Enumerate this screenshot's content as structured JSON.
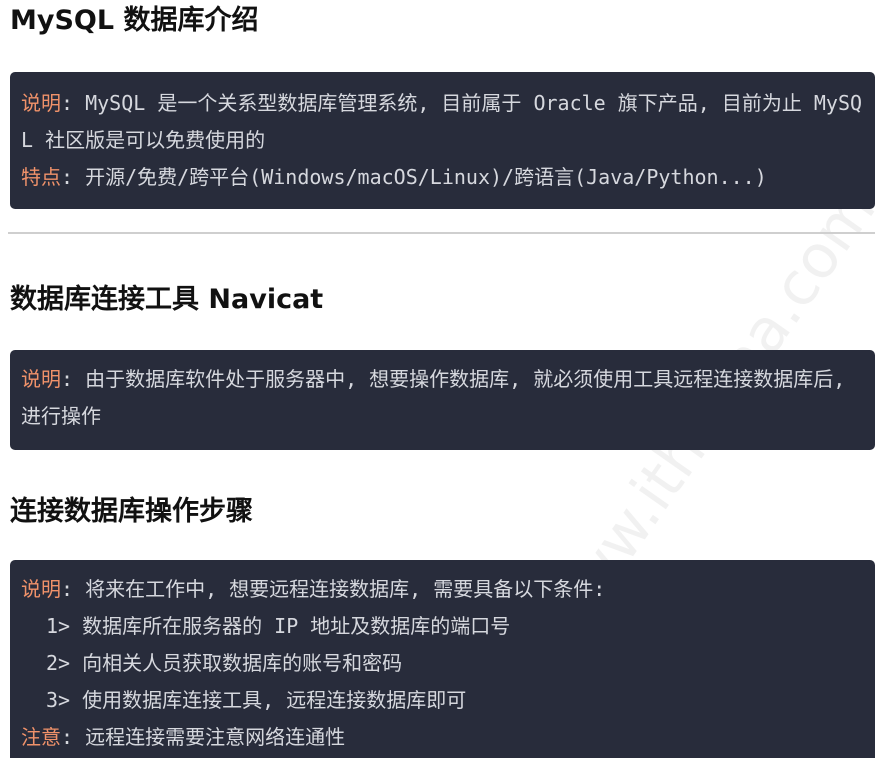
{
  "section1": {
    "title": "MySQL 数据库介绍",
    "box": {
      "line1_key": "说明",
      "line1_text": "MySQL 是一个关系型数据库管理系统, 目前属于 Oracle 旗下产品, 目前为止 MySQL 社区版是可以免费使用的",
      "line2_key": "特点",
      "line2_text": "开源/免费/跨平台(Windows/macOS/Linux)/跨语言(Java/Python...)"
    }
  },
  "section2": {
    "title": "数据库连接工具 Navicat",
    "box": {
      "line1_key": "说明",
      "line1_text": "由于数据库软件处于服务器中, 想要操作数据库, 就必须使用工具远程连接数据库后, 进行操作"
    }
  },
  "section3": {
    "title": "连接数据库操作步骤",
    "box": {
      "line1_key": "说明",
      "line1_text": "将来在工作中, 想要远程连接数据库, 需要具备以下条件:",
      "steps": [
        "1> 数据库所在服务器的 IP 地址及数据库的端口号",
        "2> 向相关人员获取数据库的账号和密码",
        "3> 使用数据库连接工具, 远程连接数据库即可"
      ],
      "note_key": "注意",
      "note_text": "远程连接需要注意网络连通性"
    }
  },
  "watermark": "www.itheima.com",
  "colors": {
    "box_background": "#282c3b",
    "key_color": "#f0926a",
    "text_color": "#d6d8de",
    "heading_color": "#111111"
  }
}
